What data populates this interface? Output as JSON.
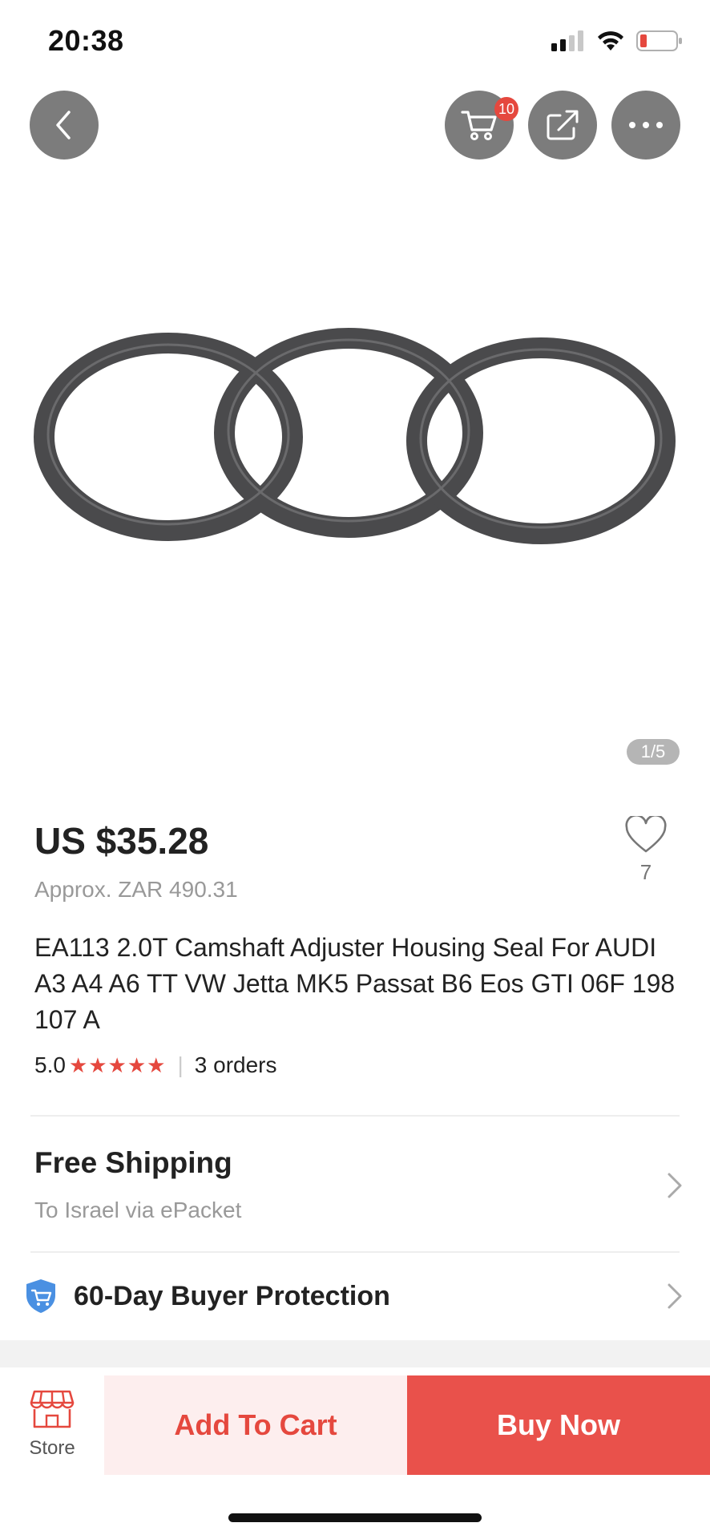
{
  "status_bar": {
    "time": "20:38",
    "icons": [
      "signal-icon",
      "wifi-icon",
      "battery-icon"
    ]
  },
  "top_actions": {
    "back_icon": "back-arrow-icon",
    "cart_icon": "cart-icon",
    "cart_badge": "10",
    "share_icon": "share-icon",
    "more_icon": "more-dots-icon"
  },
  "gallery": {
    "counter": "1/5"
  },
  "product": {
    "price": "US $35.28",
    "approx_price": "Approx. ZAR 490.31",
    "wishlist_count": "7",
    "title": "EA113 2.0T Camshaft Adjuster Housing Seal For AUDI A3 A4 A6 TT VW Jetta MK5 Passat B6 Eos GTI 06F 198 107 A",
    "rating": "5.0",
    "stars": "★★★★★",
    "orders": "3 orders"
  },
  "shipping": {
    "title": "Free Shipping",
    "subtitle": "To Israel via ePacket"
  },
  "protection": {
    "label": "60-Day Buyer Protection"
  },
  "bottom_bar": {
    "store_label": "Store",
    "add_to_cart": "Add To Cart",
    "buy_now": "Buy Now"
  },
  "colors": {
    "accent": "#e5483e",
    "buy_now_bg": "#e9514b",
    "add_cart_bg": "#fdeeee",
    "overlay_button": "#7c7c7c"
  }
}
